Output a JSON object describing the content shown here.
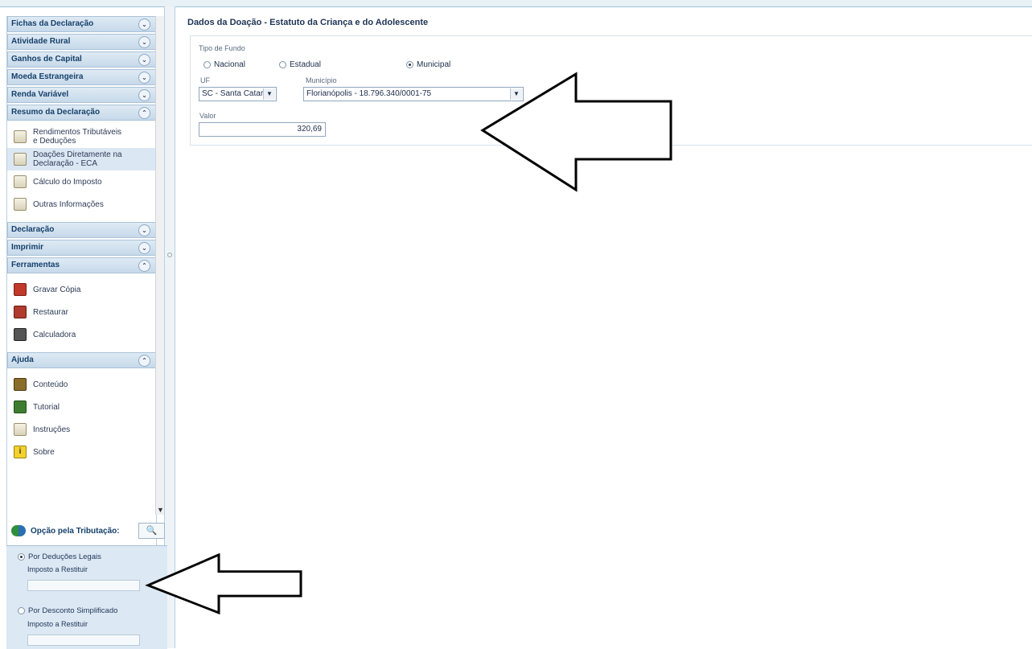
{
  "sidebar": {
    "groups": [
      {
        "label": "Fichas da Declaração",
        "toggle": "⌄"
      },
      {
        "label": "Atividade Rural",
        "toggle": "⌄"
      },
      {
        "label": "Ganhos de Capital",
        "toggle": "⌄"
      },
      {
        "label": "Moeda Estrangeira",
        "toggle": "⌄"
      },
      {
        "label": "Renda Variável",
        "toggle": "⌄"
      },
      {
        "label": "Resumo da Declaração",
        "toggle": "⌃",
        "items": [
          {
            "line1": "Rendimentos Tributáveis",
            "line2": "e Deduções",
            "icon": "document-icon"
          },
          {
            "line1": "Doações Diretamente na",
            "line2": "Declaração - ECA",
            "icon": "document-icon",
            "selected": true
          },
          {
            "line1": "Cálculo do Imposto",
            "line2": "",
            "icon": "document-icon"
          },
          {
            "line1": "Outras Informações",
            "line2": "",
            "icon": "document-icon"
          }
        ]
      },
      {
        "label": "Declaração",
        "toggle": "⌄"
      },
      {
        "label": "Imprimir",
        "toggle": "⌄"
      },
      {
        "label": "Ferramentas",
        "toggle": "⌃",
        "items": [
          {
            "line1": "Gravar Cópia",
            "icon": "floppy-icon"
          },
          {
            "line1": "Restaurar",
            "icon": "restore-icon"
          },
          {
            "line1": "Calculadora",
            "icon": "calculator-icon"
          }
        ]
      },
      {
        "label": "Ajuda",
        "toggle": "⌃",
        "items": [
          {
            "line1": "Conteúdo",
            "icon": "book-icon"
          },
          {
            "line1": "Tutorial",
            "icon": "flag-icon"
          },
          {
            "line1": "Instruções",
            "icon": "document-icon"
          },
          {
            "line1": "Sobre",
            "icon": "info-icon"
          }
        ]
      }
    ]
  },
  "opcao": {
    "title": "Opção pela Tributação:",
    "search_glyph": "🔍",
    "deducoes_label": "Por Deduções Legais",
    "deducoes_imposto_label": "Imposto a Restituir",
    "simplificado_label": "Por Desconto Simplificado",
    "simplificado_imposto_label": "Imposto a Restituir"
  },
  "main": {
    "title": "Dados da Doação - Estatuto da Criança e do Adolescente",
    "tipo_fundo_label": "Tipo de Fundo",
    "radios": {
      "nacional": "Nacional",
      "estadual": "Estadual",
      "municipal": "Municipal",
      "selected": "municipal"
    },
    "uf_label": "UF",
    "uf_value": "SC - Santa Catari",
    "municipio_label": "Município",
    "municipio_value": "Florianópolis - 18.796.340/0001-75",
    "valor_label": "Valor",
    "valor_value": "320,69"
  },
  "colors": {
    "accent": "#15406b",
    "panel": "#dce8f3"
  }
}
